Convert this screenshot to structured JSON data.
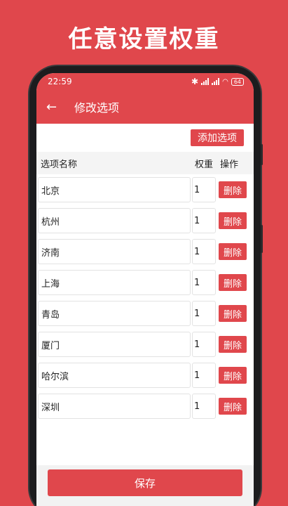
{
  "banner": {
    "headline": "任意设置权重"
  },
  "status": {
    "time": "22:59",
    "battery": "64"
  },
  "appbar": {
    "title": "修改选项",
    "back_icon": "arrow-left-icon"
  },
  "toolbar": {
    "add_label": "添加选项"
  },
  "table": {
    "headers": {
      "name": "选项名称",
      "weight": "权重",
      "action": "操作"
    },
    "rows": [
      {
        "name": "北京",
        "weight": "1",
        "delete": "删除"
      },
      {
        "name": "杭州",
        "weight": "1",
        "delete": "删除"
      },
      {
        "name": "济南",
        "weight": "1",
        "delete": "删除"
      },
      {
        "name": "上海",
        "weight": "1",
        "delete": "删除"
      },
      {
        "name": "青岛",
        "weight": "1",
        "delete": "删除"
      },
      {
        "name": "厦门",
        "weight": "1",
        "delete": "删除"
      },
      {
        "name": "哈尔滨",
        "weight": "1",
        "delete": "删除"
      },
      {
        "name": "深圳",
        "weight": "1",
        "delete": "删除"
      }
    ]
  },
  "footer": {
    "save_label": "保存"
  },
  "colors": {
    "accent": "#e0474c",
    "surface": "#ffffff",
    "header_bg": "#f4f4f4"
  }
}
